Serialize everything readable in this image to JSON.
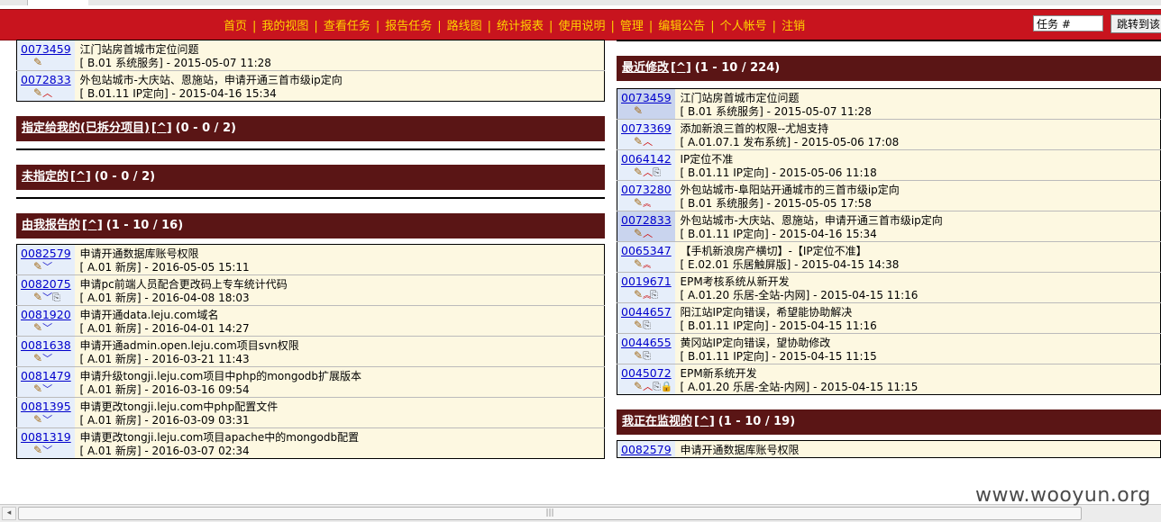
{
  "nav": {
    "links": [
      "首页",
      "我的视图",
      "查看任务",
      "报告任务",
      "路线图",
      "统计报表",
      "使用说明",
      "管理",
      "编辑公告",
      "个人帐号",
      "注销"
    ],
    "search_value": "任务 #",
    "jump_label": "跳转到该"
  },
  "left": {
    "top_rows": [
      {
        "id": "0073459",
        "title": "江门站房首城市定位问题",
        "category": "B.01 系统服务",
        "time": "2015-05-07 11:28",
        "icons": [
          "pencil"
        ]
      },
      {
        "id": "0072833",
        "title": "外包站城市-大庆站、恩施站，申请开通三首市级ip定向",
        "category": "B.01.11 IP定向",
        "time": "2015-04-16 15:34",
        "icons": [
          "pencil",
          "up"
        ]
      }
    ],
    "sections": [
      {
        "title": "指定给我的(已拆分项目)",
        "caret": "[^]",
        "range": "(0 - 0 / 2)"
      },
      {
        "title": "未指定的",
        "caret": "[^]",
        "range": "(0 - 0 / 2)"
      },
      {
        "title": "由我报告的",
        "caret": "[^]",
        "range": "(1 - 10 / 16)"
      }
    ],
    "reported_rows": [
      {
        "id": "0082579",
        "title": "申请开通数据库账号权限",
        "category": "A.01 新房",
        "time": "2016-05-05 15:11",
        "icons": [
          "pencil",
          "down"
        ]
      },
      {
        "id": "0082075",
        "title": "申请pc前端人员配合更改码上专车统计代码",
        "category": "A.01 新房",
        "time": "2016-04-08 18:03",
        "icons": [
          "pencil",
          "down",
          "clip"
        ]
      },
      {
        "id": "0081920",
        "title": "申请开通data.leju.com域名",
        "category": "A.01 新房",
        "time": "2016-04-01 14:27",
        "icons": [
          "pencil",
          "down"
        ]
      },
      {
        "id": "0081638",
        "title": "申请开通admin.open.leju.com项目svn权限",
        "category": "A.01 新房",
        "time": "2016-03-21 11:43",
        "icons": [
          "pencil",
          "down"
        ]
      },
      {
        "id": "0081479",
        "title": "申请升级tongji.leju.com项目中php的mongodb扩展版本",
        "category": "A.01 新房",
        "time": "2016-03-16 09:54",
        "icons": [
          "pencil",
          "down"
        ]
      },
      {
        "id": "0081395",
        "title": "申请更改tongji.leju.com中php配置文件",
        "category": "A.01 新房",
        "time": "2016-03-09 03:31",
        "icons": [
          "pencil",
          "down"
        ]
      },
      {
        "id": "0081319",
        "title": "申请更改tongji.leju.com项目apache中的mongodb配置",
        "category": "A.01 新房",
        "time": "2016-03-07 02:34",
        "icons": [
          "pencil",
          "down"
        ]
      }
    ]
  },
  "right": {
    "recent": {
      "title": "最近修改",
      "caret": "[^]",
      "range": "(1 - 10 / 224)"
    },
    "recent_rows": [
      {
        "id": "0073459",
        "title": "江门站房首城市定位问题",
        "category": "B.01 系统服务",
        "time": "2015-05-07 11:28",
        "icons": [
          "pencil"
        ]
      },
      {
        "id": "0073369",
        "title": "添加新浪三首的权限--尤旭支持",
        "category": "A.01.07.1 发布系统",
        "time": "2015-05-06 17:08",
        "icons": [
          "pencil",
          "up"
        ]
      },
      {
        "id": "0064142",
        "title": "IP定位不准",
        "category": "B.01.11 IP定向",
        "time": "2015-05-06 11:18",
        "icons": [
          "pencil",
          "up",
          "clip"
        ]
      },
      {
        "id": "0073280",
        "title": "外包站城市-阜阳站开通城市的三首市级ip定向",
        "category": "B.01 系统服务",
        "time": "2015-05-05 17:58",
        "icons": [
          "pencil",
          "dup"
        ]
      },
      {
        "id": "0072833",
        "title": "外包站城市-大庆站、恩施站，申请开通三首市级ip定向",
        "category": "B.01.11 IP定向",
        "time": "2015-04-16 15:34",
        "icons": [
          "pencil",
          "up"
        ]
      },
      {
        "id": "0065347",
        "title": "【手机新浪房产横切】-【IP定位不准】",
        "category": "E.02.01 乐居触屏版",
        "time": "2015-04-15 14:38",
        "icons": [
          "pencil",
          "dup"
        ]
      },
      {
        "id": "0019671",
        "title": "EPM考核系统从新开发",
        "category": "A.01.20 乐居-全站-内网",
        "time": "2015-04-15 11:16",
        "icons": [
          "pencil",
          "dup",
          "clip"
        ]
      },
      {
        "id": "0044657",
        "title": "阳江站IP定向错误，希望能协助解决",
        "category": "B.01.11 IP定向",
        "time": "2015-04-15 11:16",
        "icons": [
          "pencil",
          "clip"
        ]
      },
      {
        "id": "0044655",
        "title": "黄冈站IP定向错误，望协助修改",
        "category": "B.01.11 IP定向",
        "time": "2015-04-15 11:15",
        "icons": [
          "pencil",
          "clip"
        ]
      },
      {
        "id": "0045072",
        "title": "EPM新系统开发",
        "category": "A.01.20 乐居-全站-内网",
        "time": "2015-04-15 11:15",
        "icons": [
          "pencil",
          "up",
          "clip",
          "lock"
        ]
      }
    ],
    "monitor": {
      "title": "我正在监视的",
      "caret": "[^]",
      "range": "(1 - 10 / 19)"
    },
    "monitor_partial": {
      "id": "0082579",
      "title": "申请开通数据库账号权限"
    }
  },
  "watermark": "www.wooyun.org",
  "colors": {
    "nav_bg": "#c8141e",
    "nav_link": "#ffd400",
    "section_bg": "#5a1515",
    "row_id_bg": "#e6eefa",
    "row_desc_bg": "#fdf8e1",
    "row_highlight_id_bg": "#c9d4ee"
  }
}
